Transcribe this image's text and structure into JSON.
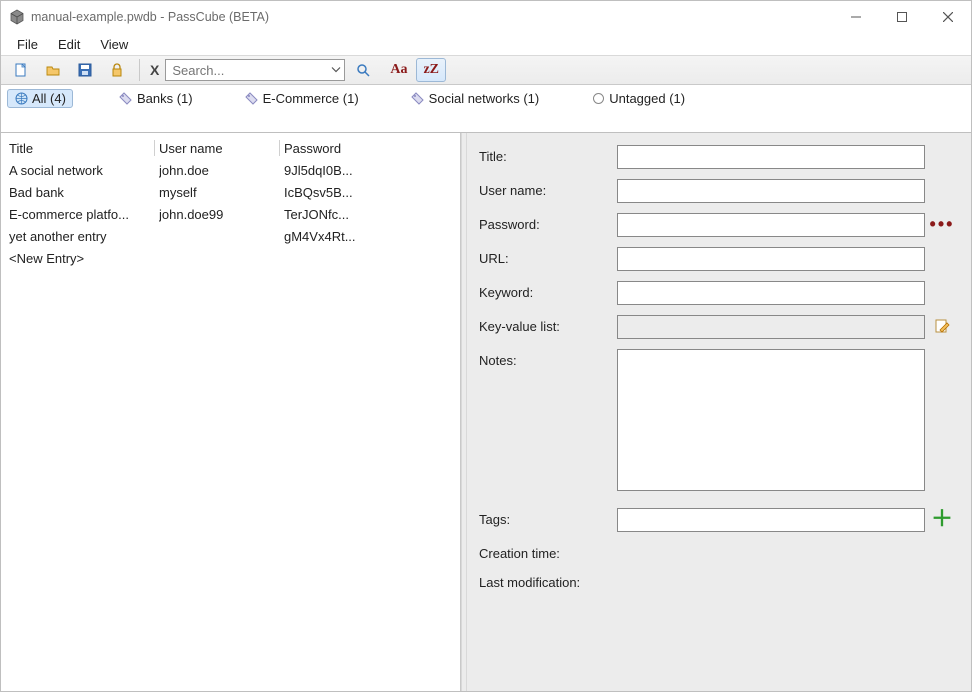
{
  "window": {
    "title": "manual-example.pwdb - PassCube (BETA)"
  },
  "menubar": [
    "File",
    "Edit",
    "View"
  ],
  "toolbar": {
    "search_placeholder": "Search...",
    "clear_label": "X",
    "aa_label": "Aa",
    "zz_label": "zZ"
  },
  "tagbar": [
    {
      "icon": "globe",
      "label": "All (4)",
      "selected": true
    },
    {
      "icon": "tag",
      "label": "Banks (1)"
    },
    {
      "icon": "tag",
      "label": "E-Commerce (1)"
    },
    {
      "icon": "tag",
      "label": "Social networks (1)"
    },
    {
      "icon": "circle",
      "label": "Untagged (1)"
    }
  ],
  "table": {
    "headers": {
      "title": "Title",
      "user": "User name",
      "pass": "Password"
    },
    "rows": [
      {
        "title": "A social network",
        "user": "john.doe",
        "pass": "9Jl5dqI0B..."
      },
      {
        "title": "Bad bank",
        "user": "myself",
        "pass": "IcBQsv5B..."
      },
      {
        "title": "E-commerce platfo...",
        "user": "john.doe99",
        "pass": "TerJONfc..."
      },
      {
        "title": "yet another entry",
        "user": "",
        "pass": "gM4Vx4Rt..."
      },
      {
        "title": "<New Entry>",
        "user": "",
        "pass": ""
      }
    ]
  },
  "form": {
    "labels": {
      "title": "Title:",
      "user": "User name:",
      "password": "Password:",
      "url": "URL:",
      "keyword": "Keyword:",
      "kvlist": "Key-value list:",
      "notes": "Notes:",
      "tags": "Tags:",
      "ctime": "Creation time:",
      "mtime": "Last modification:"
    },
    "values": {
      "title": "",
      "user": "",
      "password": "",
      "url": "",
      "keyword": "",
      "kvlist": "",
      "notes": "",
      "tags": "",
      "ctime": "",
      "mtime": ""
    }
  }
}
